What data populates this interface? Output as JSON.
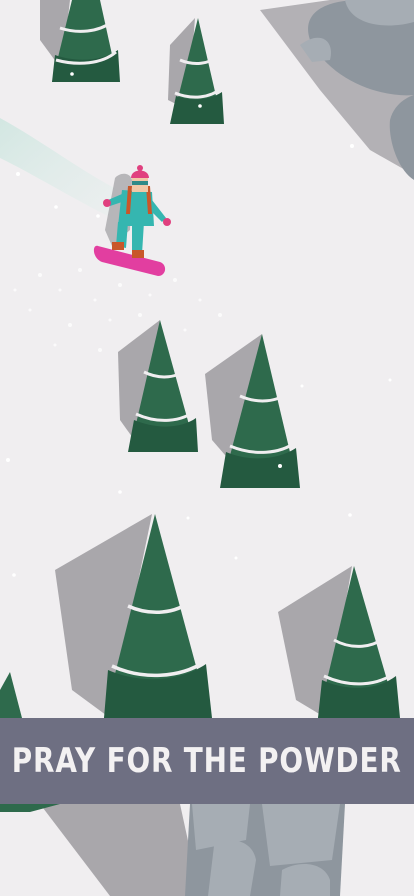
{
  "game": {
    "banner_text": "PRAY FOR THE POWDER"
  },
  "colors": {
    "snow": "#f0eef0",
    "tree_green": "#2e6a4c",
    "tree_dark": "#245a40",
    "shadow": "#a9a7ab",
    "rock": "#8c949c",
    "banner": "#6e6f82",
    "rider_jacket": "#35b6b0",
    "rider_hat": "#e0407f",
    "board": "#e23ea0"
  },
  "icons": [
    "pine-tree",
    "boulder",
    "snowboarder",
    "ski-trail"
  ]
}
